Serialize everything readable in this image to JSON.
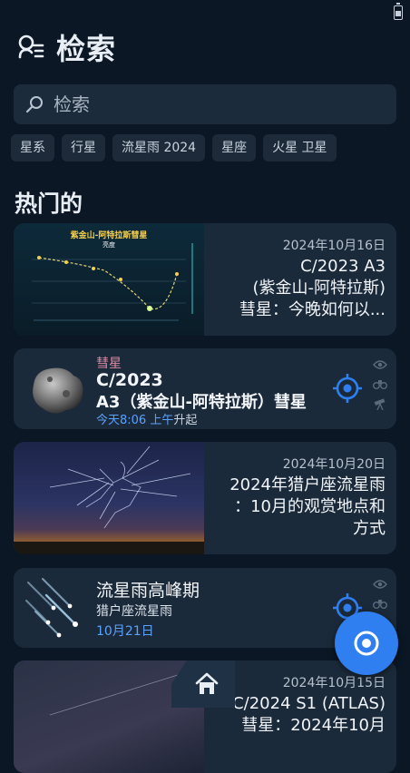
{
  "header": {
    "title": "检索"
  },
  "search": {
    "placeholder": "检索"
  },
  "chips": [
    "星系",
    "行星",
    "流星雨 2024",
    "星座",
    "火星 卫星"
  ],
  "section": {
    "title": "热门的"
  },
  "cards": {
    "comet_article": {
      "date": "2024年10月16日",
      "title_lines": [
        "C/2023 A3",
        "(紫金山-阿特拉斯)",
        "彗星：今晚如何以..."
      ],
      "chart_title": "紫金山-阿特拉斯彗星",
      "chart_subtitle": "亮度"
    },
    "comet_object": {
      "category": "彗星",
      "name_line1": "C/2023",
      "name_line2": "A3（紫金山-阿特拉斯）彗星",
      "time": "今天8:06 上午",
      "suffix": "升起"
    },
    "orionids_article": {
      "date": "2024年10月20日",
      "title_lines": [
        "2024年猎户座流星雨",
        "：10月的观赏地点和",
        "方式"
      ]
    },
    "meteor_peak": {
      "title": "流星雨高峰期",
      "subtitle": "猎户座流星雨",
      "date": "10月21日"
    },
    "atlas_article": {
      "date": "2024年10月15日",
      "title_lines": [
        "C/2024 S1 (ATLAS)",
        "彗星：2024年10月"
      ]
    }
  },
  "colors": {
    "accent": "#2f7ff0",
    "category": "#e08aa4",
    "link": "#5aa2ff",
    "background": "#0b1724",
    "card": "#1b2a3a"
  },
  "icons": [
    "battery-icon",
    "search-history-icon",
    "search-icon",
    "target-icon",
    "eye-icon",
    "binoculars-icon",
    "telescope-icon",
    "home-icon"
  ]
}
